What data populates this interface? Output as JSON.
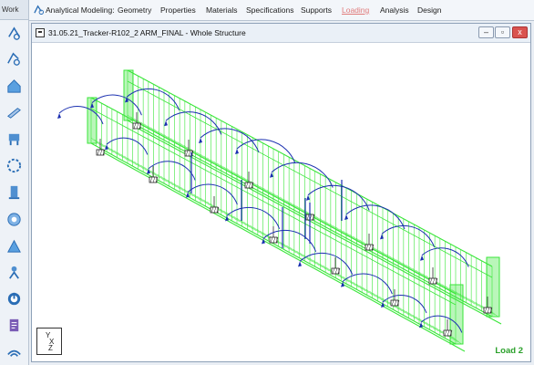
{
  "workspace": {
    "label": "Work"
  },
  "toolbar": {
    "tools": [
      {
        "icon": "analytical-modeling-icon"
      },
      {
        "icon": "geometry-icon"
      },
      {
        "icon": "house-icon"
      },
      {
        "icon": "beam-section-icon"
      },
      {
        "icon": "property-icon"
      },
      {
        "icon": "circle-dots-icon"
      },
      {
        "icon": "column-icon"
      },
      {
        "icon": "gear-sphere-icon"
      },
      {
        "icon": "load-peak-icon"
      },
      {
        "icon": "person-icon"
      },
      {
        "icon": "analysis-ring-icon"
      },
      {
        "icon": "report-icon"
      },
      {
        "icon": "wifi-icon"
      }
    ]
  },
  "menu": {
    "items": [
      {
        "label": "Analytical Modeling:"
      },
      {
        "label": "Geometry"
      },
      {
        "label": "Properties"
      },
      {
        "label": "Materials"
      },
      {
        "label": "Specifications"
      },
      {
        "label": "Supports"
      },
      {
        "label": "Loading",
        "active": true
      },
      {
        "label": "Analysis"
      },
      {
        "label": "Design"
      }
    ]
  },
  "window": {
    "title": "31.05.21_Tracker-R102_2 ARM_FINAL - Whole Structure",
    "minimize": "–",
    "restore": "▫",
    "close": "x"
  },
  "axes": {
    "y": "Y",
    "x": "X",
    "z": "Z"
  },
  "status": {
    "load_case": "Load 2"
  },
  "colors": {
    "member": "#39e639",
    "load_arrow": "#1a2fb0",
    "support": "#222222",
    "load_label": "#2aa02a"
  }
}
